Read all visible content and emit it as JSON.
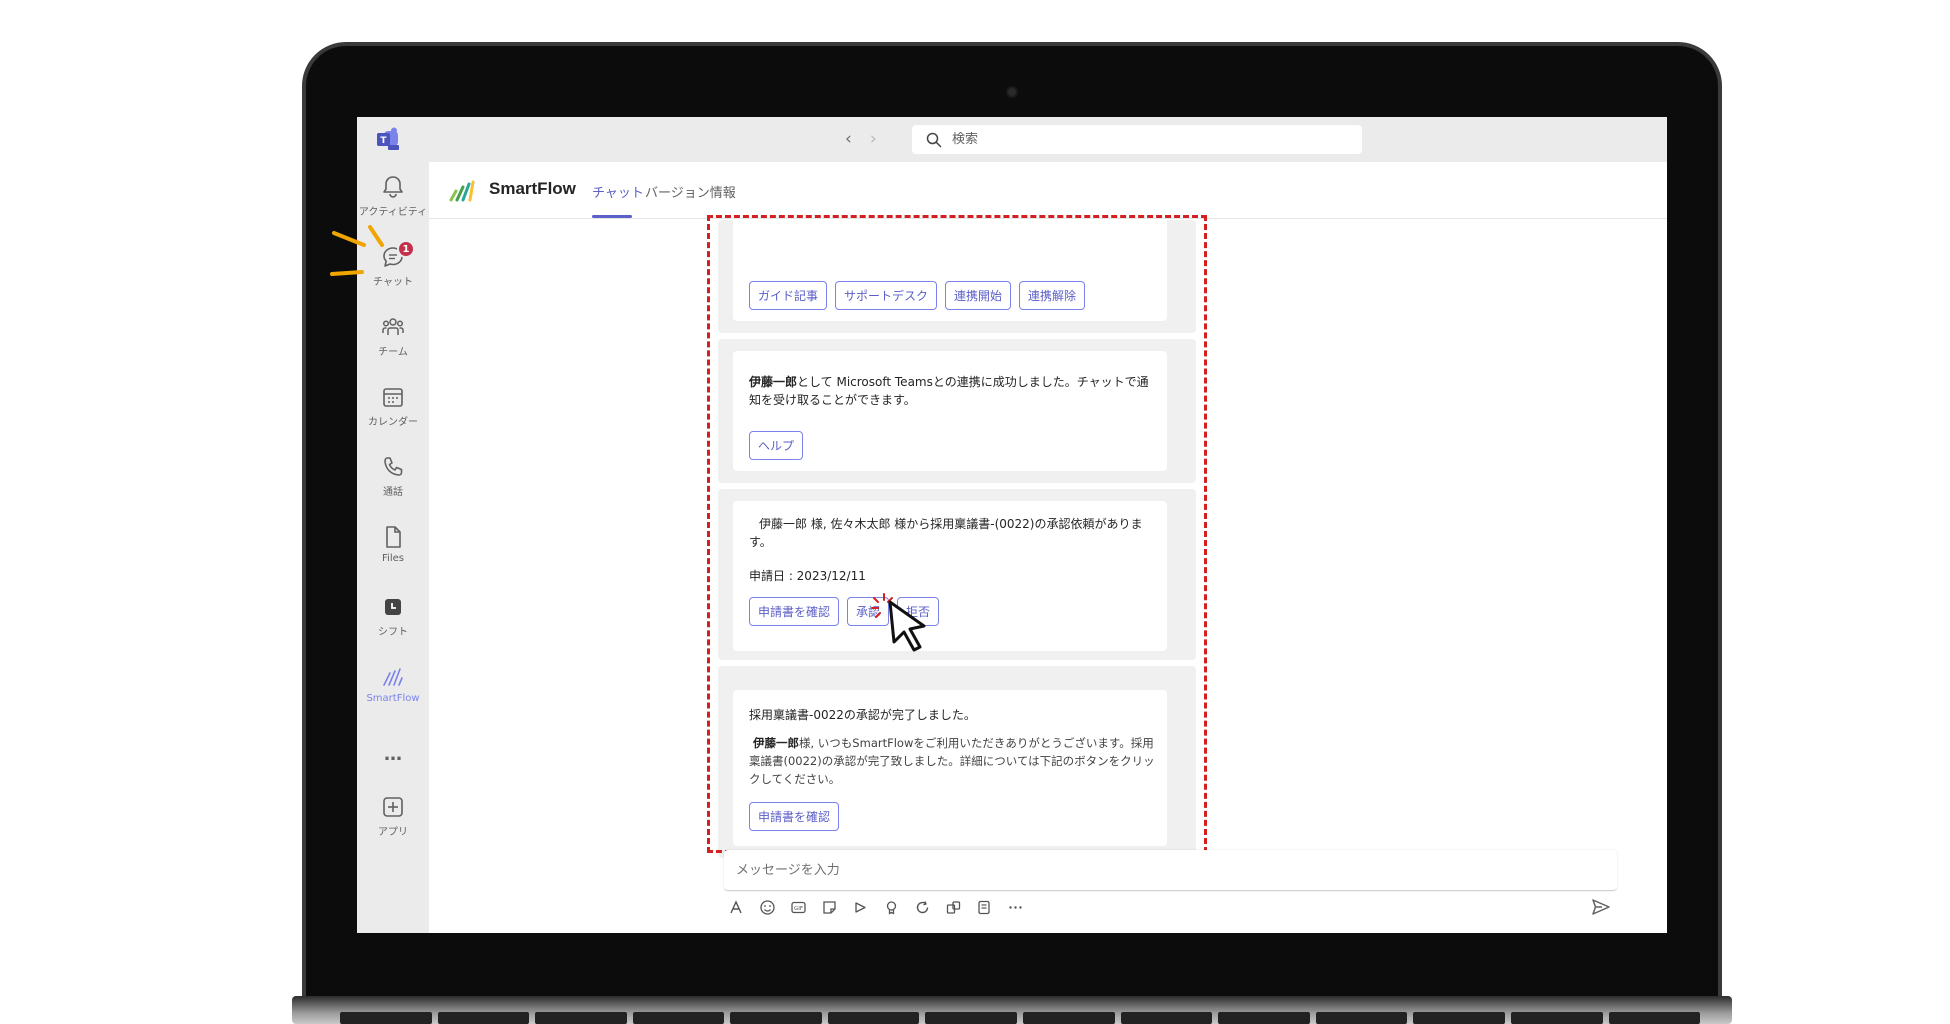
{
  "titlebar": {
    "search_placeholder": "検索",
    "back_icon": "chevron-left-icon",
    "forward_icon": "chevron-right-icon"
  },
  "rail": {
    "items": [
      {
        "label": "アクティビティ",
        "icon": "bell-icon"
      },
      {
        "label": "チャット",
        "icon": "chat-icon",
        "badge": "1"
      },
      {
        "label": "チーム",
        "icon": "people-icon"
      },
      {
        "label": "カレンダー",
        "icon": "calendar-icon"
      },
      {
        "label": "通話",
        "icon": "phone-icon"
      },
      {
        "label": "Files",
        "icon": "file-icon"
      },
      {
        "label": "シフト",
        "icon": "shift-icon"
      },
      {
        "label": "SmartFlow",
        "icon": "smartflow-icon"
      },
      {
        "label": "…",
        "icon": "more-icon"
      },
      {
        "label": "アプリ",
        "icon": "add-app-icon"
      }
    ]
  },
  "app": {
    "name": "SmartFlow",
    "tabs": [
      "チャット",
      "バージョン情報"
    ],
    "active_tab": "チャット"
  },
  "messages": {
    "m1": {
      "buttons": [
        "ガイド記事",
        "サポートデスク",
        "連携開始",
        "連携解除"
      ]
    },
    "m2": {
      "name": "伊藤一郎",
      "text": "として Microsoft Teamsとの連携に成功しました。チャットで通知を受け取ることができます。",
      "buttons": [
        "ヘルプ"
      ]
    },
    "m3": {
      "text": "伊藤一郎 様, 佐々木太郎 様から採用稟議書-(0022)の承認依頼があります。",
      "date": "申請日 : 2023/12/11",
      "buttons": [
        "申請書を確認",
        "承認",
        "拒否"
      ]
    },
    "m4": {
      "title": "採用稟議書-0022の承認が完了しました。",
      "name": "伊藤一郎",
      "text": "様, いつもSmartFlowをご利用いただきありがとうございます。採用稟議書(0022)の承認が完了致しました。詳細については下記のボタンをクリックしてください。",
      "buttons": [
        "申請書を確認"
      ]
    }
  },
  "compose": {
    "placeholder": "メッセージを入力"
  },
  "colors": {
    "accent": "#5b5fc7",
    "badge": "#c4314b",
    "highlight": "#d42020",
    "annotation": "#f0a500"
  }
}
